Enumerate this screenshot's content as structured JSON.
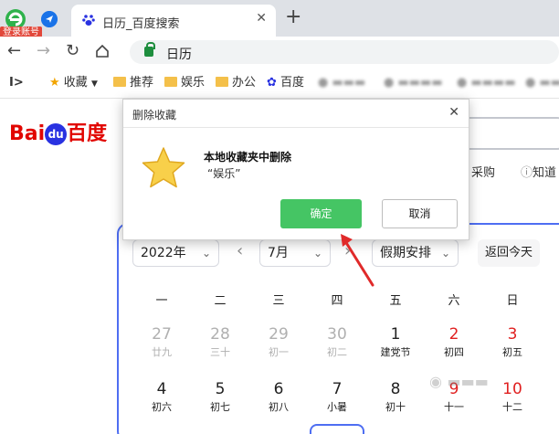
{
  "browser": {
    "login_badge": "登录账号",
    "tab_title": "日历_百度搜索",
    "tab_close": "✕",
    "newtab": "+",
    "url": "日历"
  },
  "bookmarks": [
    {
      "label": "收藏",
      "type": "star"
    },
    {
      "label": "推荐",
      "type": "folder"
    },
    {
      "label": "娱乐",
      "type": "folder"
    },
    {
      "label": "办公",
      "type": "folder"
    },
    {
      "label": "百度",
      "type": "paw"
    }
  ],
  "page": {
    "logo_bai": "Bai",
    "logo_du": "du",
    "logo_cn": "百度",
    "link_caigou": "采购",
    "link_zhidao": "知道"
  },
  "calendar": {
    "year": "2022年",
    "month": "7月",
    "holiday": "假期安排",
    "today_btn": "返回今天",
    "weekdays": [
      "一",
      "二",
      "三",
      "四",
      "五",
      "六",
      "日"
    ],
    "row1": [
      {
        "n": "27",
        "l": "廿九"
      },
      {
        "n": "28",
        "l": "三十"
      },
      {
        "n": "29",
        "l": "初一"
      },
      {
        "n": "30",
        "l": "初二"
      },
      {
        "n": "1",
        "l": "建党节"
      },
      {
        "n": "2",
        "l": "初四"
      },
      {
        "n": "3",
        "l": "初五"
      }
    ],
    "row2": [
      {
        "n": "4",
        "l": "初六"
      },
      {
        "n": "5",
        "l": "初七"
      },
      {
        "n": "6",
        "l": "初八"
      },
      {
        "n": "7",
        "l": "小暑"
      },
      {
        "n": "8",
        "l": "初十"
      },
      {
        "n": "9",
        "l": "十一"
      },
      {
        "n": "10",
        "l": "十二"
      }
    ]
  },
  "dialog": {
    "title": "删除收藏",
    "close": "✕",
    "message": "本地收藏夹中删除",
    "item": "“娱乐”",
    "ok": "确定",
    "cancel": "取消"
  },
  "colors": {
    "accent": "#4e6ef2",
    "ok_green": "#45c564",
    "holiday_red": "#e02020",
    "annotation_red": "#e02a2a"
  }
}
